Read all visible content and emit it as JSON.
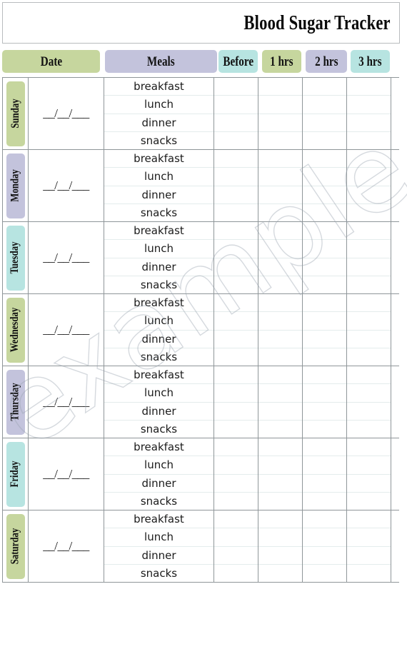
{
  "document": {
    "title": "Blood Sugar Tracker",
    "watermark": "example"
  },
  "palette": {
    "sage_green": "#c6d69e",
    "lavender": "#c3c3dc",
    "cyan": "#b7e4e1",
    "grid_line": "#8f9699",
    "inner_line": "#e4ecec",
    "title_border": "#b9bcbe",
    "text": "#111111",
    "paper": "#ffffff"
  },
  "columns": [
    {
      "label": "Date",
      "color_key": "sage_green",
      "icon": "none"
    },
    {
      "label": "Meals",
      "color_key": "lavender",
      "icon": "none"
    },
    {
      "label": "Before",
      "color_key": "cyan",
      "icon": "none"
    },
    {
      "label": "1 hrs",
      "color_key": "sage_green",
      "icon": "none"
    },
    {
      "label": "2 hrs",
      "color_key": "lavender",
      "icon": "none"
    },
    {
      "label": "3 hrs",
      "color_key": "cyan",
      "icon": "none"
    }
  ],
  "meals": [
    "breakfast",
    "lunch",
    "dinner",
    "snacks"
  ],
  "date_placeholder": "__/__/___",
  "days": [
    {
      "label": "Sunday",
      "color_key": "sage_green",
      "date_value": ""
    },
    {
      "label": "Monday",
      "color_key": "lavender",
      "date_value": ""
    },
    {
      "label": "Tuesday",
      "color_key": "cyan",
      "date_value": ""
    },
    {
      "label": "Wednesday",
      "color_key": "sage_green",
      "date_value": ""
    },
    {
      "label": "Thursday",
      "color_key": "lavender",
      "date_value": ""
    },
    {
      "label": "Friday",
      "color_key": "cyan",
      "date_value": ""
    },
    {
      "label": "Saturday",
      "color_key": "sage_green",
      "date_value": ""
    }
  ],
  "reading_columns": [
    "Before",
    "1 hrs",
    "2 hrs",
    "3 hrs"
  ]
}
